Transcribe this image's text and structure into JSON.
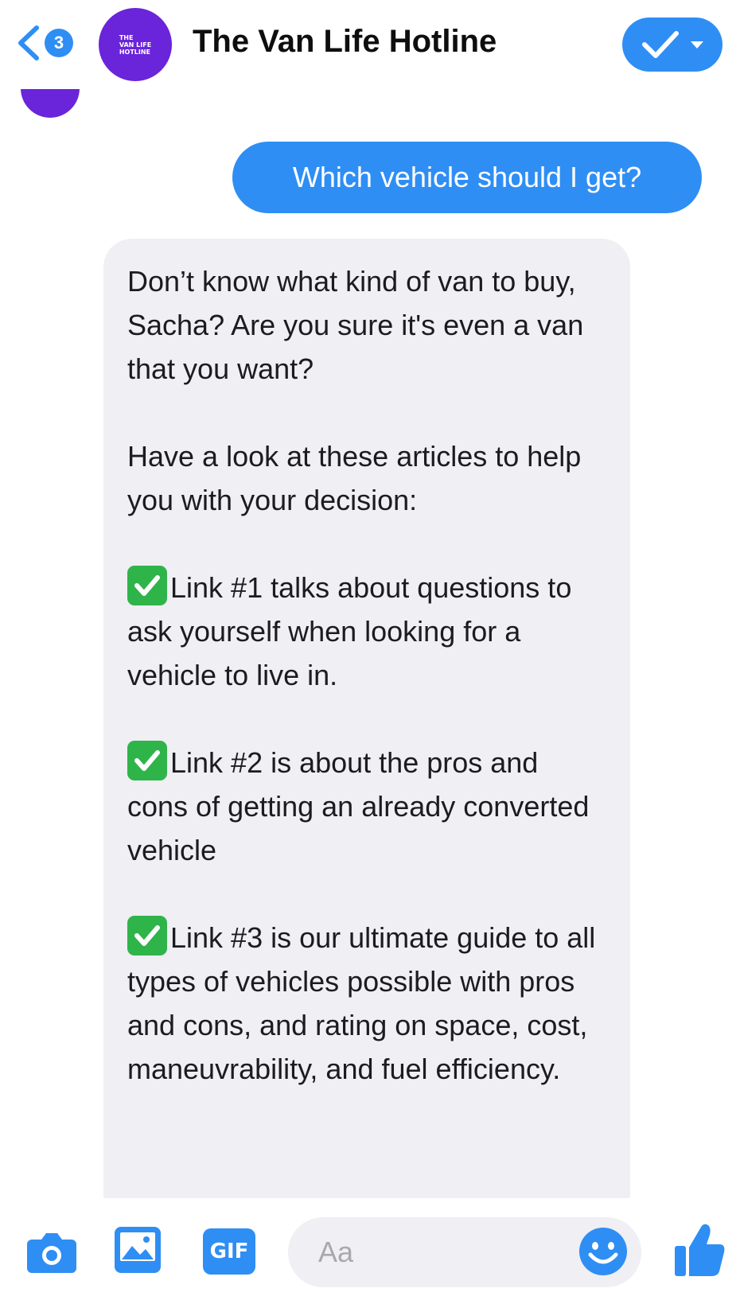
{
  "header": {
    "back_count": "3",
    "avatar_lines": [
      "THE",
      "VAN LIFE",
      "HOTLINE"
    ],
    "title": "The Van Life Hotline"
  },
  "messages": {
    "outgoing": "Which vehicle should I get?",
    "incoming": {
      "intro": "Don’t know what kind of van to buy, Sacha? Are you sure it's even a van that you want?",
      "prompt": "Have a look at these articles to help you with your decision:",
      "link1": "Link #1 talks about questions to ask yourself when looking for a vehicle to live in.",
      "link2": "Link #2 is about the pros and cons of getting an already converted vehicle",
      "link3": "Link #3 is our ultimate guide to all types of vehicles possible with pros and cons, and rating on space, cost, maneuvrability, and fuel efficiency."
    }
  },
  "composer": {
    "gif_label": "GIF",
    "input_placeholder": "Aa"
  },
  "icons": [
    "chevron-left-icon",
    "check-icon",
    "dropdown-caret-icon",
    "camera-icon",
    "image-icon",
    "gif-icon",
    "smiley-icon",
    "thumbs-up-icon",
    "checkbox-emoji-icon"
  ],
  "colors": {
    "accent": "#2f8ef4",
    "brand_purple": "#6a24d9",
    "incoming_bubble": "#efeff4",
    "check_emoji": "#2fb44a"
  }
}
